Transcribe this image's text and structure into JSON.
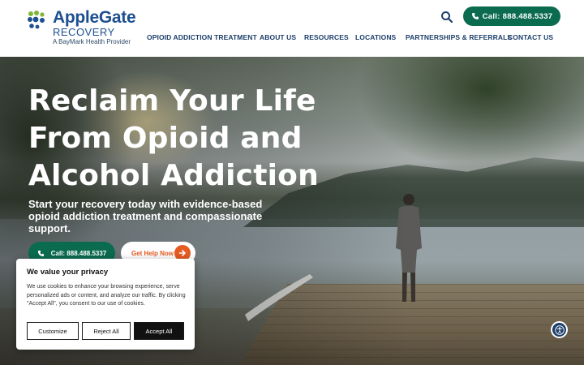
{
  "brand": {
    "name": "AppleGate",
    "sub": "RECOVERY",
    "tagline": "A BayMark Health Provider",
    "colors": {
      "navy": "#1d4f91",
      "green": "#0b6b4e",
      "orange": "#e55b22"
    }
  },
  "header": {
    "search_icon": "search-icon",
    "call_label": "Call: 888.488.5337"
  },
  "nav": {
    "items": [
      "OPIOID ADDICTION TREATMENT",
      "ABOUT US",
      "RESOURCES",
      "LOCATIONS",
      "PARTNERSHIPS & REFERRALS",
      "CONTACT US"
    ]
  },
  "hero": {
    "title": "Reclaim Your Life From Opioid and Alcohol Addiction",
    "subtitle": "Start your recovery today with evidence-based opioid addiction treatment and compassionate support.",
    "call_label": "Call: 888.488.5337",
    "help_label": "Get Help Now"
  },
  "cookie": {
    "title": "We value your privacy",
    "text": "We use cookies to enhance your browsing experience, serve personalized ads or content, and analyze our traffic. By clicking \"Accept All\", you consent to our use of cookies.",
    "customize": "Customize",
    "reject": "Reject All",
    "accept": "Accept All"
  },
  "accessibility": {
    "icon": "accessibility-icon"
  }
}
